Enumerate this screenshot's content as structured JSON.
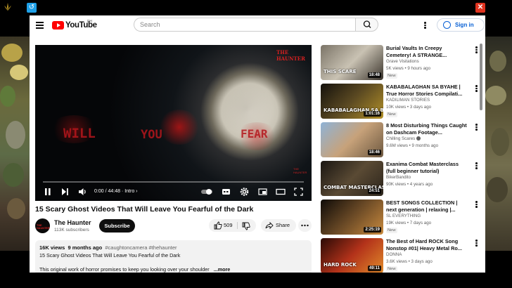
{
  "window": {
    "back_glyph": "↺",
    "close_glyph": "✕"
  },
  "header": {
    "logo_text": "YouTube",
    "region": "PH",
    "search_placeholder": "Search",
    "sign_in": "Sign in"
  },
  "player": {
    "time": "0:00 / 44:48",
    "chapter": "Intro",
    "watermark": "THE HAUNTER",
    "overlay_text": [
      "WILL",
      "YOU",
      "FEAR"
    ]
  },
  "video": {
    "title": "15 Scary Ghost Videos That Will Leave You Fearful of the Dark",
    "channel": "The Haunter",
    "subscribers": "113K subscribers",
    "subscribe_label": "Subscribe",
    "likes": "509",
    "share_label": "Share",
    "description": {
      "views": "16K views",
      "age": "9 months ago",
      "tags": "#caughtoncamera #thehaunter",
      "line1": "15 Scary Ghost Videos That Will Leave You Fearful of the Dark",
      "line2": "This original work of horror promises to keep you looking over your shoulder",
      "more": "...more"
    }
  },
  "recommended": [
    {
      "title": "Burial Vaults In Creepy Cemetery! A STRANGE...",
      "channel": "Grave Visitations",
      "meta": "5K views • 9 hours ago",
      "badge": "New",
      "duration": "18:48",
      "thumb_caption": "THIS SCARE",
      "colors": [
        "#7b7467",
        "#c9c2b3",
        "#3a342c"
      ]
    },
    {
      "title": "KABABALAGHAN SA BYAHE | True Horror Stories Compilati...",
      "channel": "KADILIMAN STORIES",
      "meta": "10K views • 3 days ago",
      "badge": "New",
      "duration": "1:01:16",
      "thumb_caption": "KABABALAGHAN SA BYAHE",
      "colors": [
        "#14110d",
        "#5c4a22",
        "#b39128"
      ]
    },
    {
      "title": "8 Most Disturbing Things Caught on Dashcam Footage...",
      "channel": "Chilling Scares",
      "meta": "9.6M views • 9 months ago",
      "badge": "",
      "duration": "18:46",
      "thumb_caption": "",
      "colors": [
        "#8fb3d6",
        "#c7a27a",
        "#6d5840"
      ],
      "verified": true
    },
    {
      "title": "Exanima Combat Masterclass (full beginner tutorial)",
      "channel": "BikerBandito",
      "meta": "90K views • 4 years ago",
      "badge": "",
      "duration": "24:51",
      "thumb_caption": "COMBAT MASTERCLASS",
      "colors": [
        "#1a1612",
        "#5a4a34",
        "#2b241b"
      ]
    },
    {
      "title": "BEST SONGS COLLECTION | next generation | relaxing |...",
      "channel": "SL EVERYTHING",
      "meta": "19K views • 7 days ago",
      "badge": "New",
      "duration": "2:25:19",
      "thumb_caption": "",
      "colors": [
        "#0e0b08",
        "#6b4a26",
        "#c98a3e"
      ]
    },
    {
      "title": "The Best of Hard ROCK Song Nonstop #01| Heavy Metal Ro...",
      "channel": "DONNA",
      "meta": "3.6K views • 3 days ago",
      "badge": "New",
      "duration": "49:11",
      "thumb_caption": "HARD ROCK",
      "colors": [
        "#2a0a06",
        "#b3321a",
        "#e08a2a"
      ]
    }
  ]
}
